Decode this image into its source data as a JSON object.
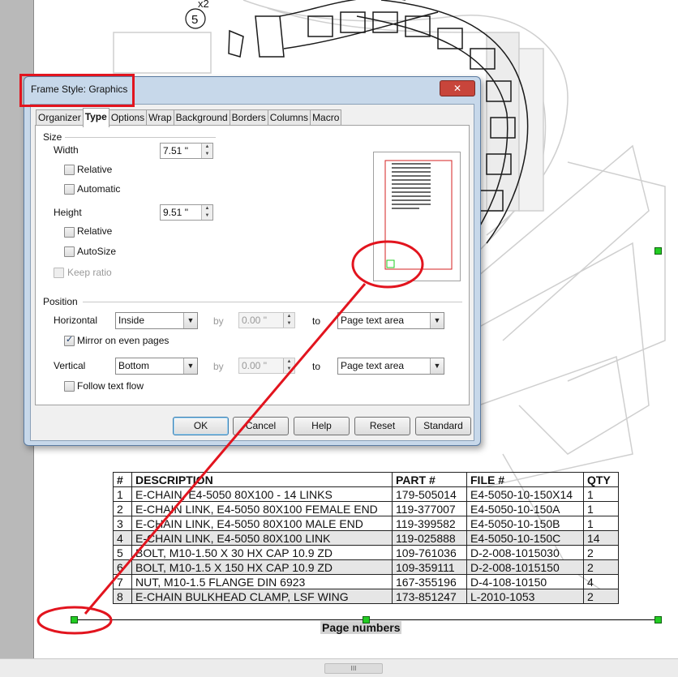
{
  "drawing": {
    "callout_number": "5",
    "quantity_note": "x2"
  },
  "dialog": {
    "title": "Frame Style: Graphics",
    "close_glyph": "✕",
    "tabs": [
      "Organizer",
      "Type",
      "Options",
      "Wrap",
      "Background",
      "Borders",
      "Columns",
      "Macro"
    ],
    "active_tab": "Type",
    "size": {
      "section_label": "Size",
      "width_label": "Width",
      "width_value": "7.51 \"",
      "width_relative": "Relative",
      "width_automatic": "Automatic",
      "height_label": "Height",
      "height_value": "9.51 \"",
      "height_relative": "Relative",
      "height_autosize": "AutoSize",
      "keep_ratio": "Keep ratio"
    },
    "position": {
      "section_label": "Position",
      "horizontal_label": "Horizontal",
      "horizontal_value": "Inside",
      "horizontal_by_label": "by",
      "horizontal_by_value": "0.00 \"",
      "horizontal_to_label": "to",
      "horizontal_to_value": "Page text area",
      "mirror_label": "Mirror on even pages",
      "vertical_label": "Vertical",
      "vertical_value": "Bottom",
      "vertical_by_label": "by",
      "vertical_by_value": "0.00 \"",
      "vertical_to_label": "to",
      "vertical_to_value": "Page text area",
      "follow_label": "Follow text flow"
    },
    "buttons": {
      "ok": "OK",
      "cancel": "Cancel",
      "help": "Help",
      "reset": "Reset",
      "standard": "Standard"
    }
  },
  "bom_table": {
    "headers": [
      "#",
      "DESCRIPTION",
      "PART #",
      "FILE #",
      "QTY"
    ],
    "rows": [
      [
        "1",
        "E-CHAIN, E4-5050 80X100 - 14 LINKS",
        "179-505014",
        "E4-5050-10-150X14",
        "1"
      ],
      [
        "2",
        "E-CHAIN LINK, E4-5050 80X100 FEMALE END",
        "119-377007",
        "E4-5050-10-150A",
        "1"
      ],
      [
        "3",
        "E-CHAIN LINK, E4-5050 80X100 MALE END",
        "119-399582",
        "E4-5050-10-150B",
        "1"
      ],
      [
        "4",
        "E-CHAIN LINK, E4-5050 80X100 LINK",
        "119-025888",
        "E4-5050-10-150C",
        "14"
      ],
      [
        "5",
        "BOLT, M10-1.50 X 30 HX CAP 10.9 ZD",
        "109-761036",
        "D-2-008-1015030",
        "2"
      ],
      [
        "6",
        "BOLT, M10-1.5 X 150 HX CAP 10.9 ZD",
        "109-359111",
        "D-2-008-1015150",
        "2"
      ],
      [
        "7",
        "NUT, M10-1.5 FLANGE DIN 6923",
        "167-355196",
        "D-4-108-10150",
        "4"
      ],
      [
        "8",
        "E-CHAIN BULKHEAD CLAMP, LSF WING",
        "173-851247",
        "L-2010-1053",
        "2"
      ]
    ]
  },
  "footer": {
    "text": "Page numbers"
  },
  "scrollbar": {
    "grip": "III"
  },
  "colors": {
    "annotation": "#e2141e",
    "handle": "#22cc22"
  }
}
